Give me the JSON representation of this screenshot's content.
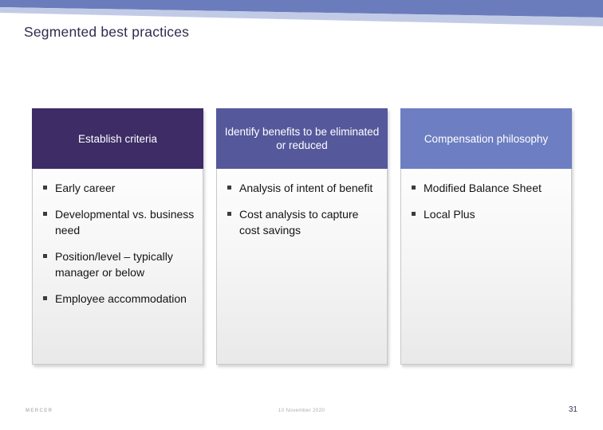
{
  "slide": {
    "title": "Segmented best practices",
    "title_color": "#2f2b4f"
  },
  "decoration": {
    "band_dark_color": "#6b7cbd",
    "band_light_color": "#c2cbe6"
  },
  "columns": [
    {
      "header": "Establish criteria",
      "header_color": "#3d2c66",
      "bullets": [
        "Early career",
        "Developmental vs. business need",
        "Position/level – typically manager or below",
        "Employee accommodation"
      ]
    },
    {
      "header": "Identify benefits to be eliminated or reduced",
      "header_color": "#56589c",
      "bullets": [
        "Analysis of intent of benefit",
        "Cost analysis to capture cost savings"
      ]
    },
    {
      "header": "Compensation philosophy",
      "header_color": "#6d7fc2",
      "bullets": [
        "Modified Balance Sheet",
        "Local Plus"
      ]
    }
  ],
  "footer": {
    "logo": "MERCER",
    "date": "10 November 2020",
    "page_number": "31"
  }
}
